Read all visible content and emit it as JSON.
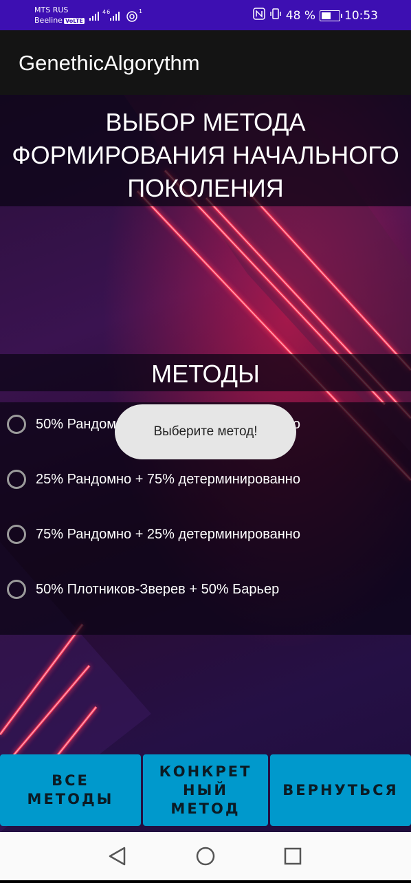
{
  "status_bar": {
    "carrier_1": "MTS RUS",
    "carrier_2": "Beeline",
    "volte": "VoLTE",
    "network": "46",
    "sim_index": "1",
    "battery": "48 %",
    "time": "10:53"
  },
  "app_bar": {
    "title": "GenethicAlgorythm"
  },
  "header": {
    "title": "ВЫБОР МЕТОДА ФОРМИРОВАНИЯ НАЧАЛЬНОГО ПОКОЛЕНИЯ"
  },
  "methods": {
    "title": "МЕТОДЫ",
    "options": [
      {
        "label": "50% Рандомно + 50% детерминированно",
        "selected": false
      },
      {
        "label": "25% Рандомно + 75% детерминированно",
        "selected": false
      },
      {
        "label": "75% Рандомно + 25% детерминированно",
        "selected": false
      },
      {
        "label": "50% Плотников-Зверев + 50% Барьер",
        "selected": false
      }
    ]
  },
  "toast": {
    "text": "Выберите метод!"
  },
  "buttons": {
    "all_methods": "ВСЕ\nМЕТОДЫ",
    "specific_method": "КОНКРЕТ\nНЫЙ\nМЕТОД",
    "back": "ВЕРНУТЬСЯ"
  },
  "nav": {
    "back_icon": "back-triangle-icon",
    "home_icon": "home-circle-icon",
    "recents_icon": "recents-square-icon"
  }
}
